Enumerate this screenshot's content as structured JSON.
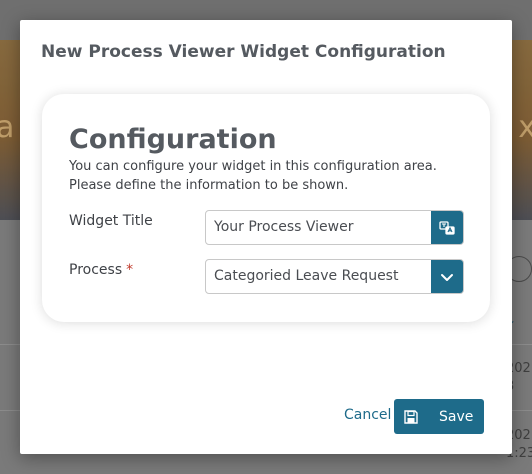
{
  "background": {
    "banner_left_glyph": "a",
    "banner_right_glyph": "x",
    "dates": [
      "202",
      "3",
      "202",
      "1:23"
    ]
  },
  "modal": {
    "title": "New Process Viewer Widget Configuration",
    "card": {
      "heading": "Configuration",
      "description": "You can configure your widget in this configuration area. Please define the information to be shown."
    },
    "fields": {
      "widget_title": {
        "label": "Widget Title",
        "value": "Your Process Viewer",
        "button_icon": "translate-icon"
      },
      "process": {
        "label": "Process",
        "required_marker": "*",
        "value": "Categoried Leave Request",
        "button_icon": "chevron-down-icon"
      }
    },
    "footer": {
      "cancel_label": "Cancel",
      "save_label": "Save",
      "save_icon": "save-icon"
    }
  },
  "colors": {
    "accent": "#1e6b8a",
    "required": "#c0392b",
    "text": "#3f4247"
  }
}
